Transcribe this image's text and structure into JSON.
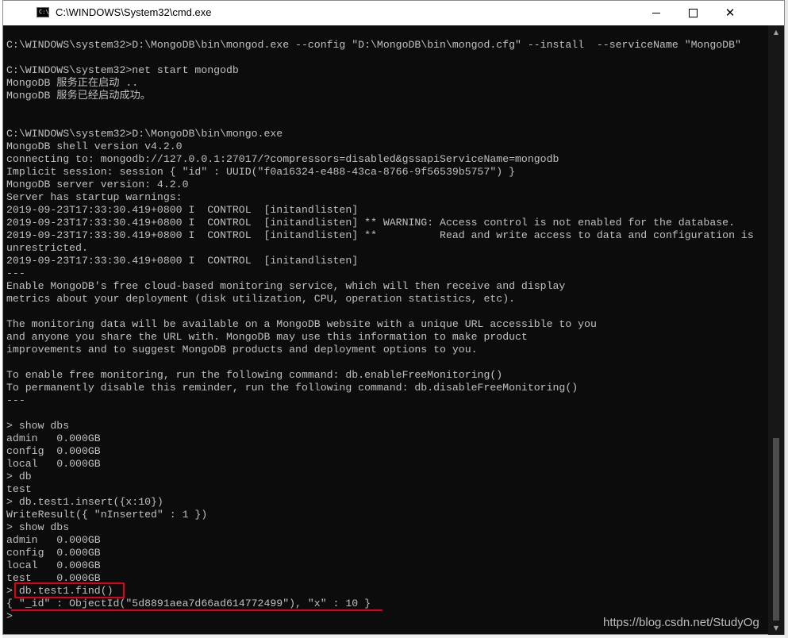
{
  "window": {
    "title": "C:\\WINDOWS\\System32\\cmd.exe",
    "icon": "console-app-icon",
    "icon_glyph": "C:\\"
  },
  "controls": {
    "minimize_icon": "minimize-icon",
    "maximize_icon": "maximize-icon",
    "close_icon": "close-icon",
    "close_glyph": "✕"
  },
  "scrollbar": {
    "up_glyph": "▲",
    "down_glyph": "▼"
  },
  "console": {
    "lines": [
      "C:\\WINDOWS\\system32>D:\\MongoDB\\bin\\mongod.exe --config \"D:\\MongoDB\\bin\\mongod.cfg\" --install  --serviceName \"MongoDB\"",
      "",
      "C:\\WINDOWS\\system32>net start mongodb",
      "MongoDB 服务正在启动 ..",
      "MongoDB 服务已经启动成功。",
      "",
      "",
      "C:\\WINDOWS\\system32>D:\\MongoDB\\bin\\mongo.exe",
      "MongoDB shell version v4.2.0",
      "connecting to: mongodb://127.0.0.1:27017/?compressors=disabled&gssapiServiceName=mongodb",
      "Implicit session: session { \"id\" : UUID(\"f0a16324-e488-43ca-8766-9f56539b5757\") }",
      "MongoDB server version: 4.2.0",
      "Server has startup warnings:",
      "2019-09-23T17:33:30.419+0800 I  CONTROL  [initandlisten]",
      "2019-09-23T17:33:30.419+0800 I  CONTROL  [initandlisten] ** WARNING: Access control is not enabled for the database.",
      "2019-09-23T17:33:30.419+0800 I  CONTROL  [initandlisten] **          Read and write access to data and configuration is",
      "unrestricted.",
      "2019-09-23T17:33:30.419+0800 I  CONTROL  [initandlisten]",
      "---",
      "Enable MongoDB's free cloud-based monitoring service, which will then receive and display",
      "metrics about your deployment (disk utilization, CPU, operation statistics, etc).",
      "",
      "The monitoring data will be available on a MongoDB website with a unique URL accessible to you",
      "and anyone you share the URL with. MongoDB may use this information to make product",
      "improvements and to suggest MongoDB products and deployment options to you.",
      "",
      "To enable free monitoring, run the following command: db.enableFreeMonitoring()",
      "To permanently disable this reminder, run the following command: db.disableFreeMonitoring()",
      "---",
      "",
      "> show dbs",
      "admin   0.000GB",
      "config  0.000GB",
      "local   0.000GB",
      "> db",
      "test",
      "> db.test1.insert({x:10})",
      "WriteResult({ \"nInserted\" : 1 })",
      "> show dbs",
      "admin   0.000GB",
      "config  0.000GB",
      "local   0.000GB",
      "test    0.000GB",
      "> db.test1.find()",
      "{ \"_id\" : ObjectId(\"5d8891aea7d66ad614772499\"), \"x\" : 10 }",
      ">"
    ]
  },
  "annotation": {
    "color": "#e0001b",
    "boxed_command": "db.test1.find()",
    "underlined_result": "{ \"_id\" : ObjectId(\"5d8891aea7d66ad614772499\"), \"x\" : 10 }"
  },
  "watermark": "https://blog.csdn.net/StudyOg"
}
